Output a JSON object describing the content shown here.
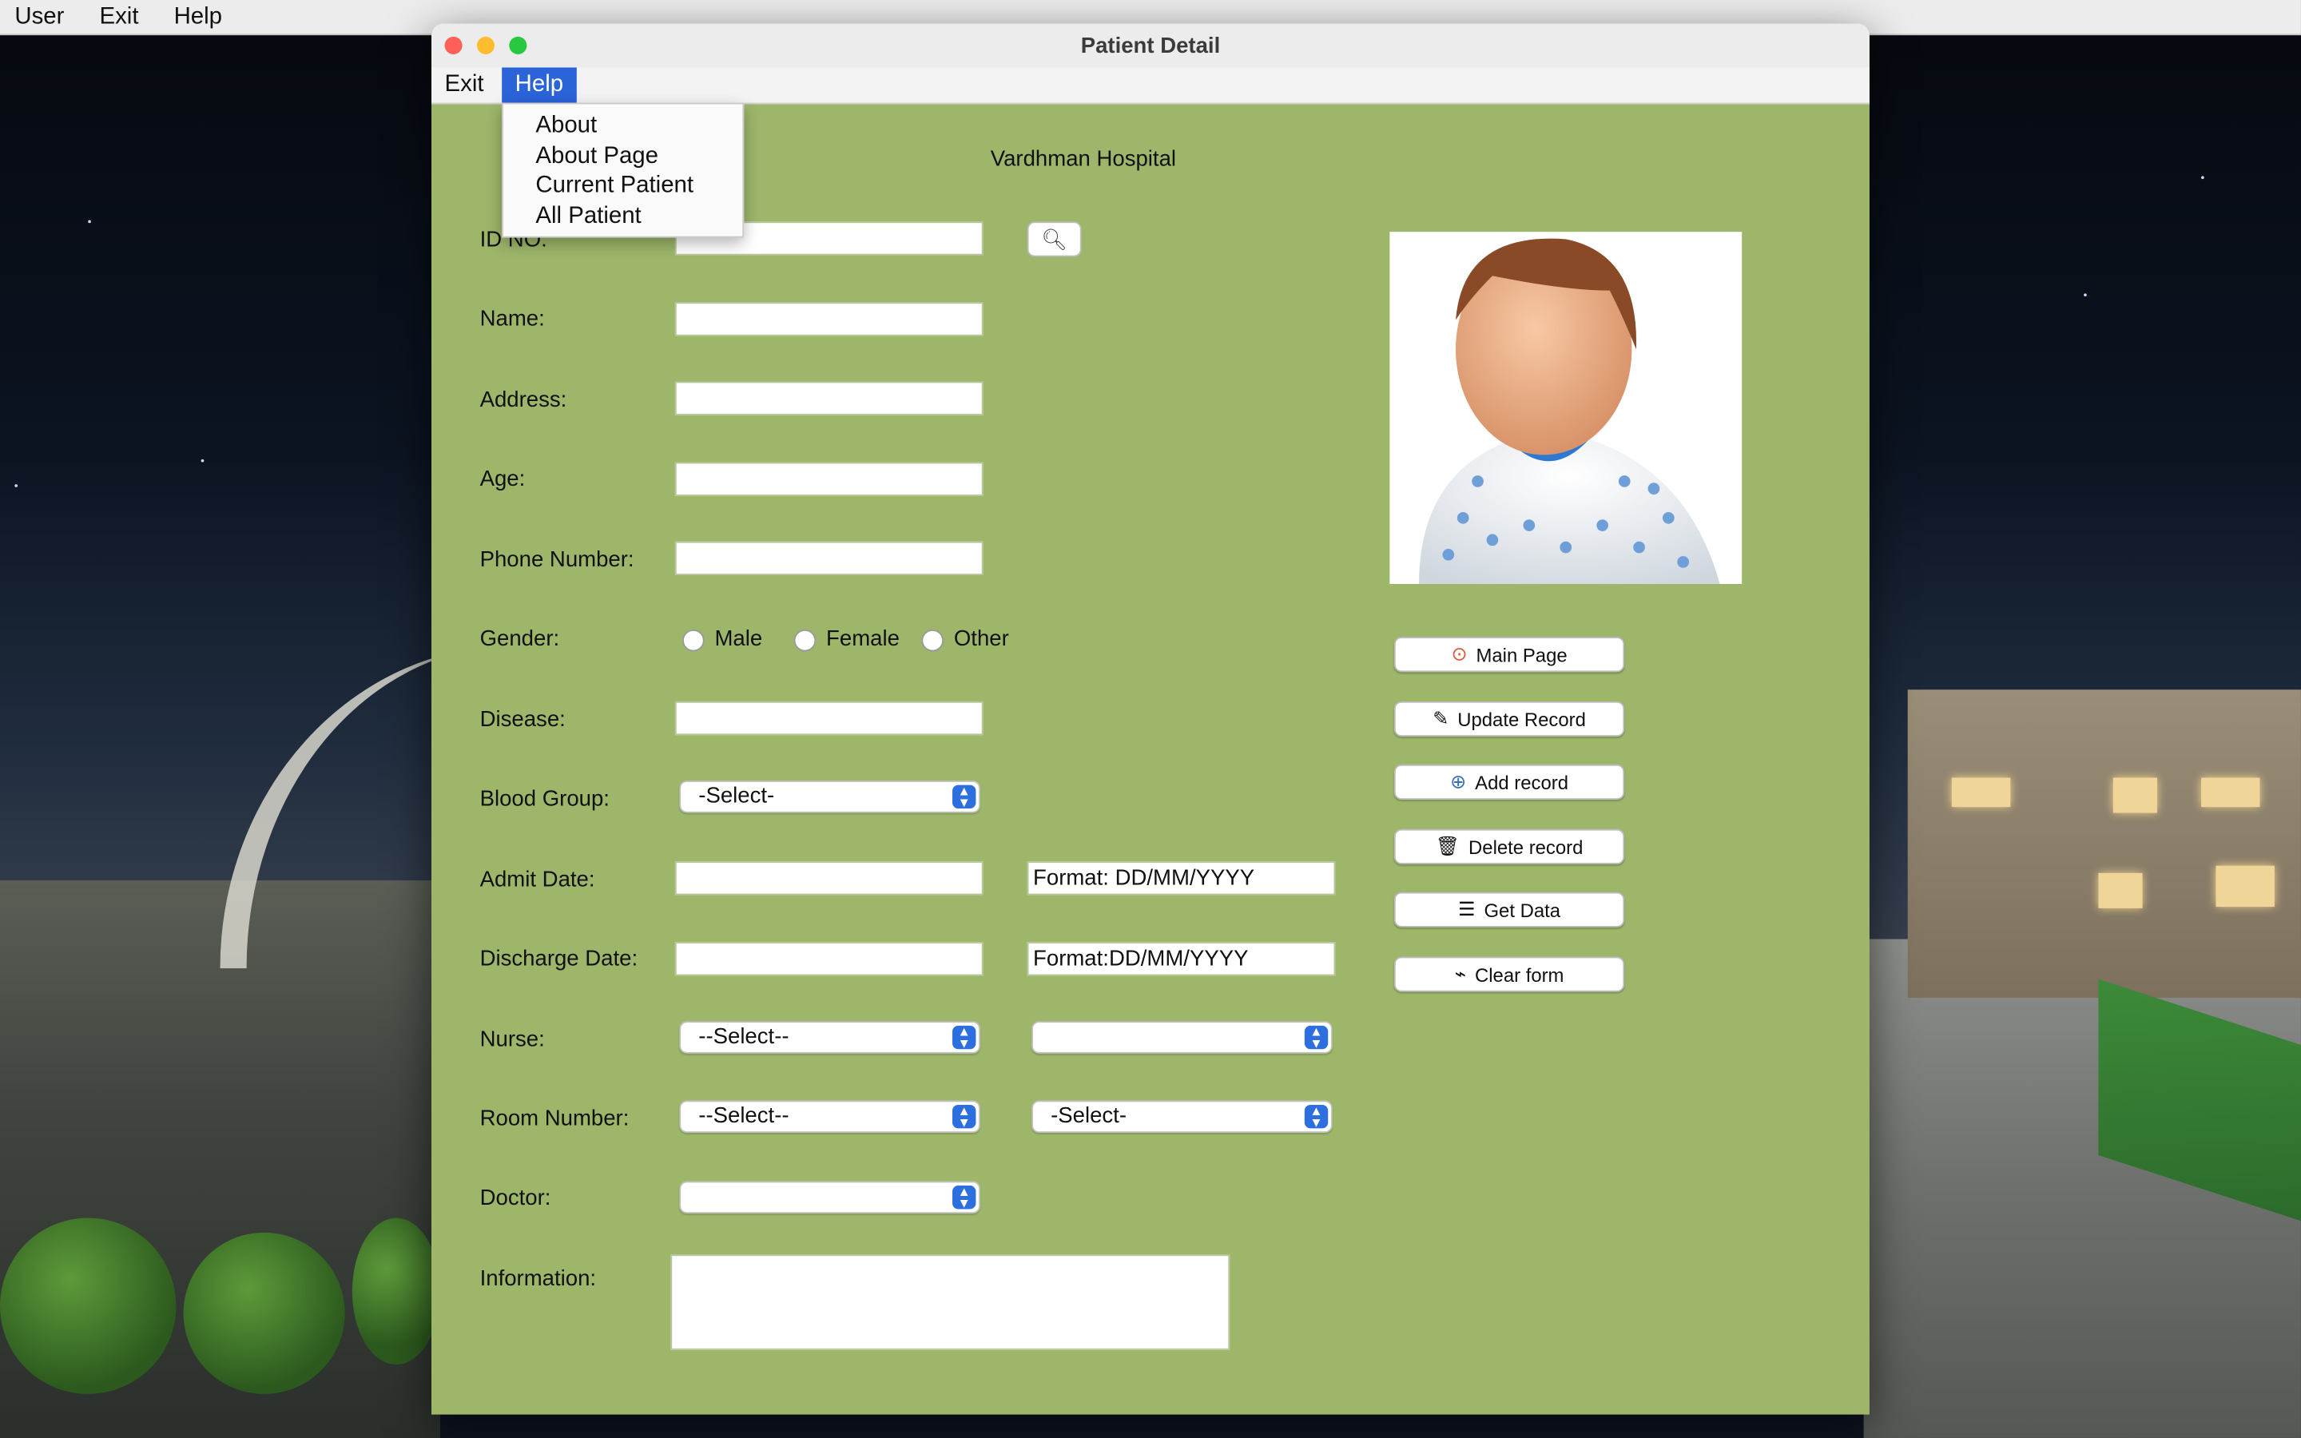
{
  "system_menu": {
    "items": [
      "User",
      "Exit",
      "Help"
    ]
  },
  "window": {
    "title": "Patient Detail",
    "menu": {
      "exit": "Exit",
      "help": "Help"
    },
    "help_dropdown": [
      "About",
      "About Page",
      "Current Patient",
      "All Patient"
    ],
    "hospital_name": "Vardhman Hospital"
  },
  "form": {
    "id_label": "ID NO:",
    "name_label": "Name:",
    "address_label": "Address:",
    "age_label": "Age:",
    "phone_label": "Phone Number:",
    "gender_label": "Gender:",
    "gender_options": [
      "Male",
      "Female",
      "Other"
    ],
    "disease_label": "Disease:",
    "blood_group_label": "Blood Group:",
    "blood_group_value": "-Select-",
    "admit_date_label": "Admit Date:",
    "admit_format": "Format: DD/MM/YYYY",
    "discharge_date_label": "Discharge Date:",
    "discharge_format": "Format:DD/MM/YYYY",
    "nurse_label": "Nurse:",
    "nurse_value": "--Select--",
    "nurse_value_2": "",
    "room_label": "Room Number:",
    "room_value": "--Select--",
    "room_value_2": "-Select-",
    "doctor_label": "Doctor:",
    "doctor_value": "",
    "information_label": "Information:"
  },
  "buttons": {
    "main_page": "Main Page",
    "update_record": "Update Record",
    "add_record": "Add record",
    "delete_record": "Delete record",
    "get_data": "Get Data",
    "clear_form": "Clear form"
  },
  "icons": {
    "search": "search-icon",
    "main_page": "home-icon",
    "update": "edit-icon",
    "add": "add-icon",
    "delete": "trash-icon",
    "get_data": "database-icon",
    "clear": "broom-icon",
    "patient_photo": "patient-avatar"
  }
}
